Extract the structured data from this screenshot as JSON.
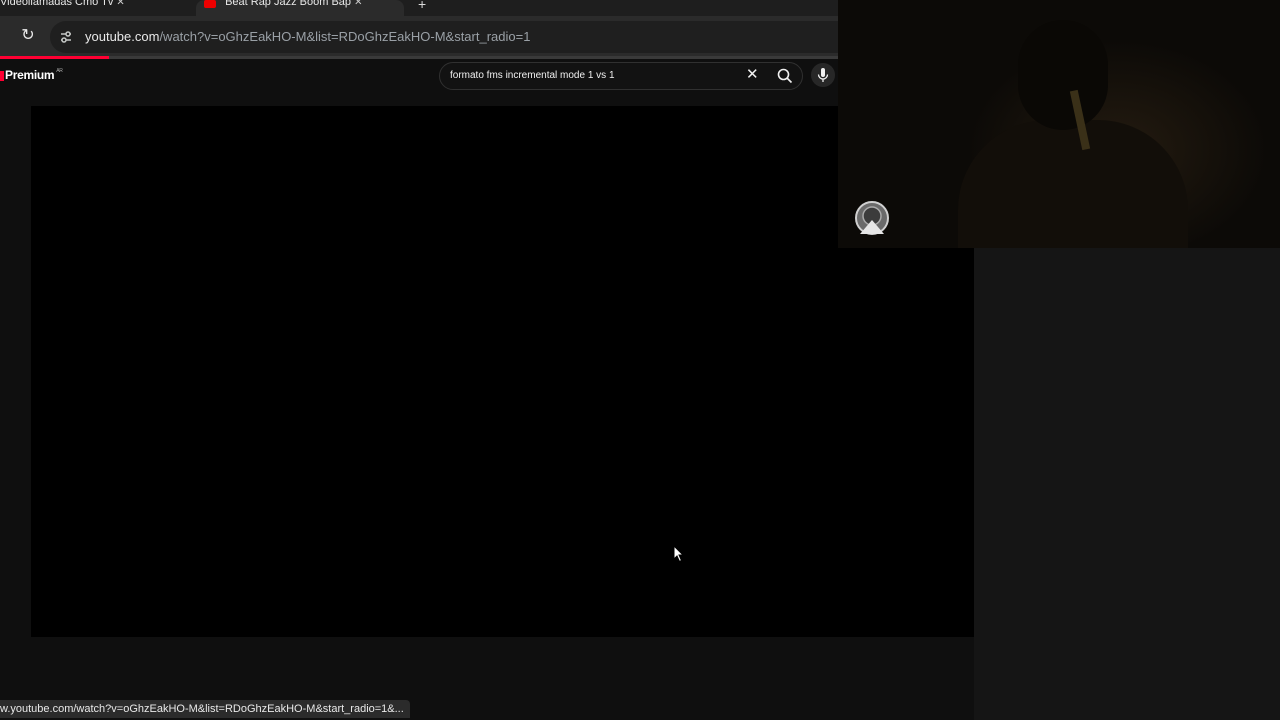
{
  "browser": {
    "tabs": [
      {
        "title": "Videollamadas Cmo Tv",
        "active": false
      },
      {
        "title": "Beat Rap Jazz Boom Bap",
        "active": true
      }
    ],
    "new_tab_symbol": "+",
    "reload_symbol": "↻",
    "url": {
      "host": "youtube.com",
      "path": "/watch?v=oGhzEakHO-M&list=RDoGhzEakHO-M&start_radio=1"
    },
    "load_progress": 0.13,
    "status_url": "w.youtube.com/watch?v=oGhzEakHO-M&list=RDoGhzEakHO-M&start_radio=1&..."
  },
  "youtube": {
    "logo_text": "Premium",
    "logo_region": "AR",
    "search": {
      "query": "formato fms incremental mode 1 vs 1",
      "clear_symbol": "✕"
    }
  },
  "icons": {
    "reload": "reload-icon",
    "site_info": "site-info-icon",
    "search": "search-icon",
    "mic": "microphone-icon",
    "overlay": "overlay-app-icon",
    "cursor": "mouse-cursor-icon"
  },
  "colors": {
    "accent": "#ff0033",
    "background": "#0f0f0f",
    "toolbar": "#2b2b2b"
  }
}
